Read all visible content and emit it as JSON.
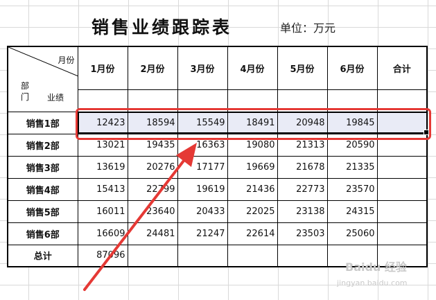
{
  "title": "销售业绩跟踪表",
  "unit": "单位：万元",
  "diag_header": {
    "top_right": "月份",
    "bottom_left": "部门",
    "bottom_right": "业绩"
  },
  "columns": [
    "1月份",
    "2月份",
    "3月份",
    "4月份",
    "5月份",
    "6月份",
    "合计"
  ],
  "rows": [
    {
      "dept": "销售1部",
      "values": [
        "12423",
        "18594",
        "15549",
        "18491",
        "20948",
        "19845"
      ],
      "total": ""
    },
    {
      "dept": "销售2部",
      "values": [
        "13021",
        "19435",
        "16363",
        "19080",
        "21313",
        "20590"
      ],
      "total": ""
    },
    {
      "dept": "销售3部",
      "values": [
        "13619",
        "20276",
        "17177",
        "19669",
        "21678",
        "21335"
      ],
      "total": ""
    },
    {
      "dept": "销售4部",
      "values": [
        "15413",
        "22799",
        "19619",
        "21436",
        "22773",
        "23570"
      ],
      "total": ""
    },
    {
      "dept": "销售5部",
      "values": [
        "16011",
        "23640",
        "20433",
        "22025",
        "23138",
        "24315"
      ],
      "total": ""
    },
    {
      "dept": "销售6部",
      "values": [
        "16609",
        "24481",
        "21247",
        "22614",
        "23503",
        "25060"
      ],
      "total": ""
    }
  ],
  "total_row": {
    "label": "总计",
    "values": [
      "87096",
      "",
      "",
      "",
      "",
      "",
      ""
    ]
  },
  "watermark": {
    "brand": "Baidu 经验",
    "url": "jingyan.baidu.com"
  },
  "colors": {
    "highlight": "#e53935",
    "selection_fill": "#e9ebf6",
    "grid": "#d9d9d9"
  }
}
